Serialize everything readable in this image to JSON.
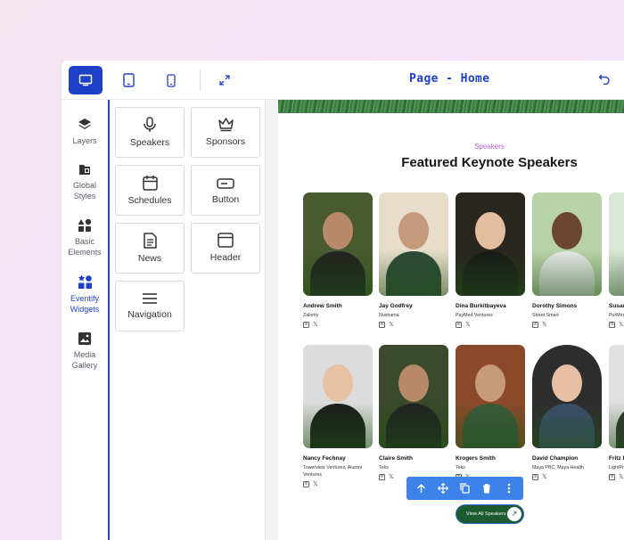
{
  "toolbar": {
    "page_title": "Page - Home",
    "devices": [
      "desktop-icon",
      "tablet-icon",
      "mobile-icon"
    ],
    "accent": "#1e40c8"
  },
  "rail": {
    "items": [
      {
        "label": "Layers",
        "icon": "layers-icon"
      },
      {
        "label": "Global Styles",
        "icon": "global-styles-icon"
      },
      {
        "label": "Basic Elements",
        "icon": "shapes-icon"
      },
      {
        "label": "Eventify Widgets",
        "icon": "widgets-icon",
        "active": true
      },
      {
        "label": "Media Gallery",
        "icon": "image-icon"
      }
    ]
  },
  "widgets": [
    {
      "label": "Speakers",
      "icon": "microphone-icon"
    },
    {
      "label": "Sponsors",
      "icon": "crown-icon"
    },
    {
      "label": "Schedules",
      "icon": "calendar-icon"
    },
    {
      "label": "Button",
      "icon": "button-icon"
    },
    {
      "label": "News",
      "icon": "document-icon"
    },
    {
      "label": "Header",
      "icon": "window-icon"
    },
    {
      "label": "Navigation",
      "icon": "menu-icon"
    }
  ],
  "section": {
    "kicker": "Speakers",
    "heading": "Featured Keynote Speakers",
    "view_all_label": "View All Speakers",
    "speakers": [
      {
        "name": "Andrew Smith",
        "company": "Zalority",
        "skin": "#b98a6a",
        "bg": "#4a5a30",
        "shirt": "#222"
      },
      {
        "name": "Jay Godfrey",
        "company": "Nushama",
        "skin": "#c49a7a",
        "bg": "#e8dccb",
        "shirt": "#2e4a3a"
      },
      {
        "name": "Dina Burkitbayeva",
        "company": "PayMed Ventures",
        "skin": "#e3bfa0",
        "bg": "#2a2620",
        "shirt": "#1a1a1a"
      },
      {
        "name": "Dorothy Simons",
        "company": "Street Smart",
        "skin": "#6b4632",
        "bg": "#b9d3a8",
        "shirt": "#eaeaea"
      },
      {
        "name": "Susan",
        "company": "PurMin",
        "skin": "#e0c0a8",
        "bg": "#d8e8d8",
        "shirt": "#ddd"
      },
      {
        "name": "Nancy Fechnay",
        "company": "Towerview Ventures, Alumni Ventures",
        "skin": "#e6c2a2",
        "bg": "#dcdcdc",
        "shirt": "#1d1d1d"
      },
      {
        "name": "Claire Smith",
        "company": "Teks",
        "skin": "#b98a6a",
        "bg": "#3a4a2a",
        "shirt": "#222"
      },
      {
        "name": "Krogers Smith",
        "company": "Teks",
        "skin": "#c79a7a",
        "bg": "#8a4a2a",
        "shirt": "#3a5a3a"
      },
      {
        "name": "David Champion",
        "company": "Maya PBC, Maya Health",
        "skin": "#e6bfa5",
        "bg": "#2e2e2e",
        "shirt": "#3a4e6a"
      },
      {
        "name": "Fritz I",
        "company": "LightPr",
        "skin": "#d0b0a0",
        "bg": "#e0e0e0",
        "shirt": "#333"
      }
    ]
  }
}
